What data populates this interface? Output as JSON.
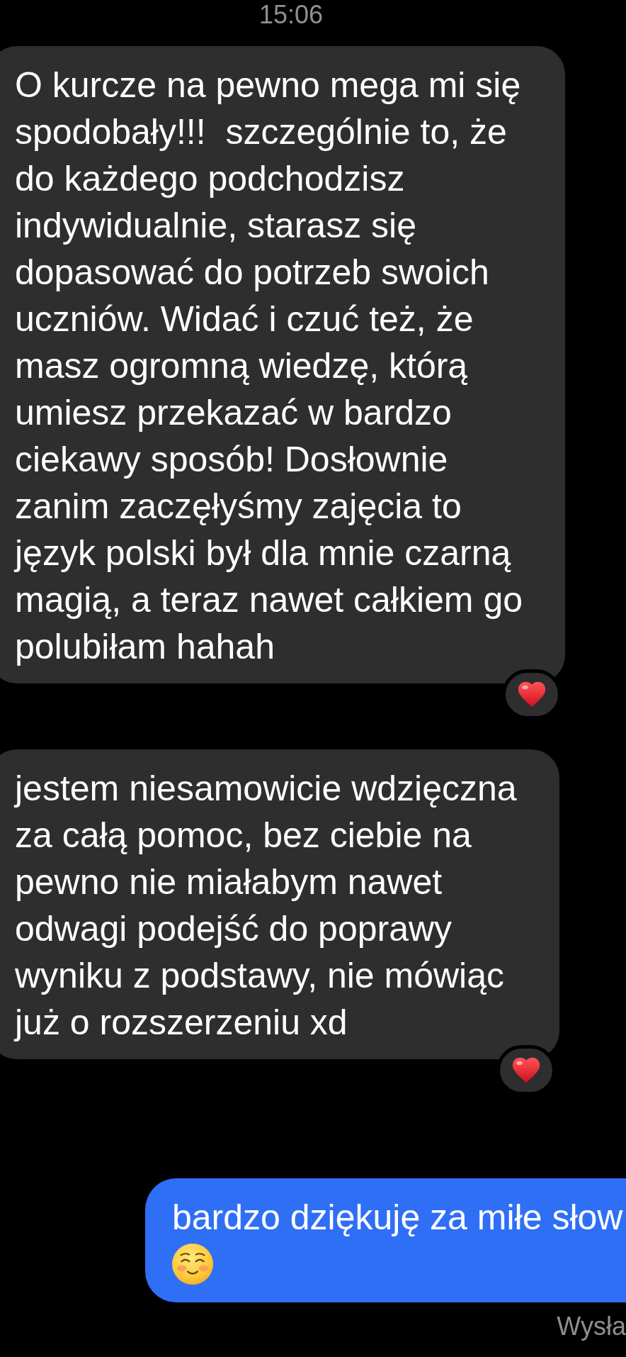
{
  "timestamp": "15:06",
  "messages": [
    {
      "kind": "received",
      "text": "O kurcze na pewno mega mi się\nspodobały!!!  szczególnie to, że\ndo każdego podchodzisz\nindywidualnie, starasz się\ndopasować do potrzeb swoich\nuczniów. Widać i czuć też, że\nmasz ogromną wiedzę, którą\numiesz przekazać w bardzo\nciekawy sposób! Dosłownie\nzanim zaczęłyśmy zajęcia to\njęzyk polski był dla mnie czarną\nmagią, a teraz nawet całkiem go\npolubiłam hahah",
      "emoji": false,
      "reaction": true
    },
    {
      "kind": "received",
      "text": "jestem niesamowicie wdzięczna\nza całą pomoc, bez ciebie na\npewno nie miałabym nawet\nodwagi podejść do poprawy\nwyniku z podstawy, nie mówiąc\njuż o rozszerzeniu xd",
      "emoji": false,
      "reaction": true
    },
    {
      "kind": "sent",
      "text": "bardzo dziękuję za miłe słow",
      "emoji": true,
      "reaction": false
    }
  ],
  "delivery_status": "Wysła"
}
